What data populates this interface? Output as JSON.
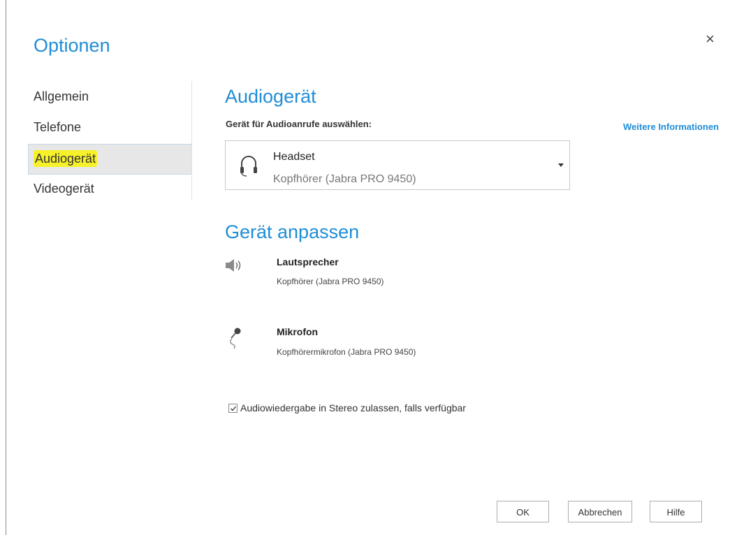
{
  "dialog": {
    "title": "Optionen",
    "close_glyph": "×"
  },
  "sidebar": {
    "items": [
      {
        "label": "Allgemein"
      },
      {
        "label": "Telefone"
      },
      {
        "label": "Audiogerät"
      },
      {
        "label": "Videogerät"
      }
    ],
    "selected_index": 2
  },
  "audio": {
    "heading": "Audiogerät",
    "select_label": "Gerät für Audioanrufe auswählen:",
    "more_info": "Weitere Informationen",
    "device": {
      "icon": "headset-icon",
      "name": "Headset",
      "detail": "Kopfhörer (Jabra PRO 9450)"
    }
  },
  "customize": {
    "heading": "Gerät anpassen",
    "speaker": {
      "icon": "speaker-icon",
      "label": "Lautsprecher",
      "device": "Kopfhörer (Jabra PRO 9450)"
    },
    "microphone": {
      "icon": "microphone-icon",
      "label": "Mikrofon",
      "device": "Kopfhörermikrofon (Jabra PRO 9450)"
    }
  },
  "stereo": {
    "label": "Audiowiedergabe in Stereo zulassen, falls verfügbar",
    "checked": true
  },
  "buttons": {
    "ok": "OK",
    "cancel": "Abbrechen",
    "help": "Hilfe"
  },
  "colors": {
    "accent": "#1f8dd6",
    "highlight": "#f7f12a",
    "selected_bg": "#e7e7e7"
  }
}
